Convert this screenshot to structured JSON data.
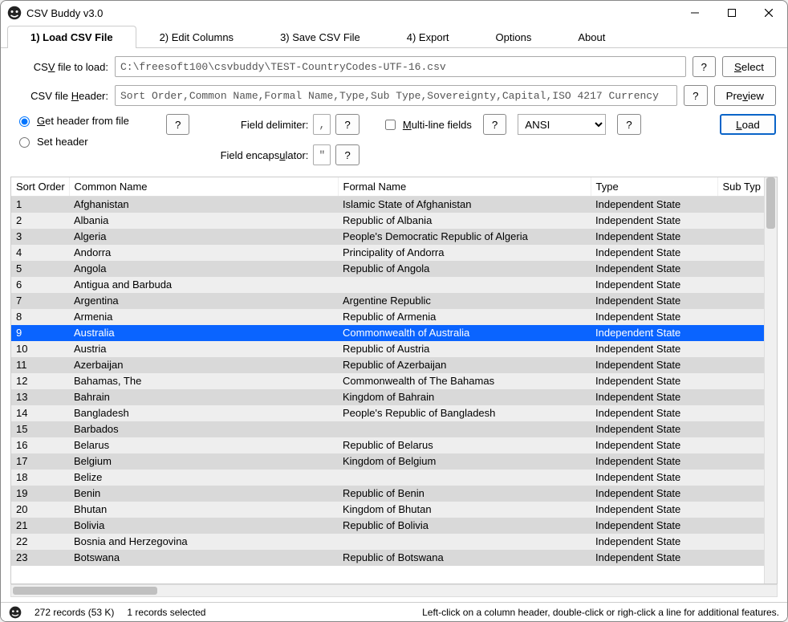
{
  "window": {
    "title": "CSV Buddy v3.0"
  },
  "tabs": {
    "load": "1) Load CSV File",
    "edit": "2) Edit Columns",
    "save": "3) Save CSV File",
    "export": "4) Export",
    "options": "Options",
    "about": "About"
  },
  "form": {
    "file_label_pre": "CS",
    "file_label_u": "V",
    "file_label_post": " file to load:",
    "file_value": "C:\\freesoft100\\csvbuddy\\TEST-CountryCodes-UTF-16.csv",
    "header_label_pre": "CSV file ",
    "header_label_u": "H",
    "header_label_post": "eader:",
    "header_value": "Sort Order,Common Name,Formal Name,Type,Sub Type,Sovereignty,Capital,ISO 4217 Currency",
    "q": "?",
    "select_pre": "",
    "select_u": "S",
    "select_post": "elect",
    "preview_pre": "Pre",
    "preview_u": "v",
    "preview_post": "iew",
    "load_pre": "",
    "load_u": "L",
    "load_post": "oad"
  },
  "opts": {
    "get_header_pre": "",
    "get_header_u": "G",
    "get_header_post": "et header from  file",
    "set_header": "Set header",
    "field_delim": "Field delimiter:",
    "field_delim_val": ",",
    "field_encap_pre": "Field encaps",
    "field_encap_u": "u",
    "field_encap_post": "lator:",
    "field_encap_val": "\"",
    "multiline_pre": "",
    "multiline_u": "M",
    "multiline_post": "ulti-line fields",
    "encoding": "ANSI"
  },
  "grid": {
    "columns": [
      "Sort Order",
      "Common Name",
      "Formal Name",
      "Type",
      "Sub Typ"
    ],
    "selected_index": 8,
    "rows": [
      {
        "so": "1",
        "cn": "Afghanistan",
        "fn": "Islamic State of Afghanistan",
        "ty": "Independent State"
      },
      {
        "so": "2",
        "cn": "Albania",
        "fn": "Republic of Albania",
        "ty": "Independent State"
      },
      {
        "so": "3",
        "cn": "Algeria",
        "fn": "People's Democratic Republic of Algeria",
        "ty": "Independent State"
      },
      {
        "so": "4",
        "cn": "Andorra",
        "fn": "Principality of Andorra",
        "ty": "Independent State"
      },
      {
        "so": "5",
        "cn": "Angola",
        "fn": "Republic of Angola",
        "ty": "Independent State"
      },
      {
        "so": "6",
        "cn": "Antigua and Barbuda",
        "fn": "",
        "ty": "Independent State"
      },
      {
        "so": "7",
        "cn": "Argentina",
        "fn": "Argentine Republic",
        "ty": "Independent State"
      },
      {
        "so": "8",
        "cn": "Armenia",
        "fn": "Republic of Armenia",
        "ty": "Independent State"
      },
      {
        "so": "9",
        "cn": "Australia",
        "fn": "Commonwealth of Australia",
        "ty": "Independent State"
      },
      {
        "so": "10",
        "cn": "Austria",
        "fn": "Republic of Austria",
        "ty": "Independent State"
      },
      {
        "so": "11",
        "cn": "Azerbaijan",
        "fn": "Republic of Azerbaijan",
        "ty": "Independent State"
      },
      {
        "so": "12",
        "cn": "Bahamas, The",
        "fn": "Commonwealth of The Bahamas",
        "ty": "Independent State"
      },
      {
        "so": "13",
        "cn": "Bahrain",
        "fn": "Kingdom of Bahrain",
        "ty": "Independent State"
      },
      {
        "so": "14",
        "cn": "Bangladesh",
        "fn": "People's Republic of Bangladesh",
        "ty": "Independent State"
      },
      {
        "so": "15",
        "cn": "Barbados",
        "fn": "",
        "ty": "Independent State"
      },
      {
        "so": "16",
        "cn": "Belarus",
        "fn": "Republic of Belarus",
        "ty": "Independent State"
      },
      {
        "so": "17",
        "cn": "Belgium",
        "fn": "Kingdom of Belgium",
        "ty": "Independent State"
      },
      {
        "so": "18",
        "cn": "Belize",
        "fn": "",
        "ty": "Independent State"
      },
      {
        "so": "19",
        "cn": "Benin",
        "fn": "Republic of Benin",
        "ty": "Independent State"
      },
      {
        "so": "20",
        "cn": "Bhutan",
        "fn": "Kingdom of Bhutan",
        "ty": "Independent State"
      },
      {
        "so": "21",
        "cn": "Bolivia",
        "fn": "Republic of Bolivia",
        "ty": "Independent State"
      },
      {
        "so": "22",
        "cn": "Bosnia and Herzegovina",
        "fn": "",
        "ty": "Independent State"
      },
      {
        "so": "23",
        "cn": "Botswana",
        "fn": "Republic of Botswana",
        "ty": "Independent State"
      }
    ]
  },
  "status": {
    "records": "272 records (53 K)",
    "selected": "1 records selected",
    "hint": "Left-click on a column header, double-click or righ-click a line for additional features."
  }
}
